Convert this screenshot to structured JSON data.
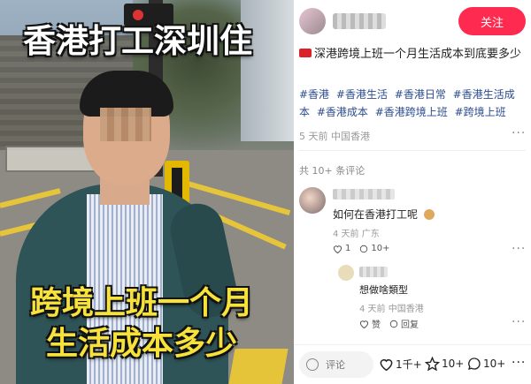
{
  "video": {
    "caption_top": "香港打工深圳住",
    "caption_bottom_line1": "跨境上班一个月",
    "caption_bottom_line2": "生活成本多少"
  },
  "header": {
    "follow_label": "关注"
  },
  "post": {
    "title": "深港跨境上班一个月生活成本到底要多少",
    "tags": [
      "#香港",
      "#香港生活",
      "#香港日常",
      "#香港生活成本",
      "#香港成本",
      "#香港跨境上班",
      "#跨境上班"
    ],
    "meta": "5 天前 中国香港"
  },
  "comments": {
    "count_label": "共 10+ 条评论",
    "items": [
      {
        "text": "如何在香港打工呢",
        "meta": "4 天前 广东",
        "like_count": "1",
        "reply_count": "10+"
      },
      {
        "text": "想做啥類型",
        "meta": "4 天前 中国香港",
        "like_label": "赞",
        "reply_label": "回复"
      }
    ]
  },
  "bottom_bar": {
    "comment_placeholder": "评论",
    "likes": "1千+",
    "favorites": "10+",
    "comments": "10+"
  },
  "colors": {
    "accent": "#ff2a4f",
    "tag": "#2a4b8d",
    "caption_yellow": "#f6e23b"
  }
}
